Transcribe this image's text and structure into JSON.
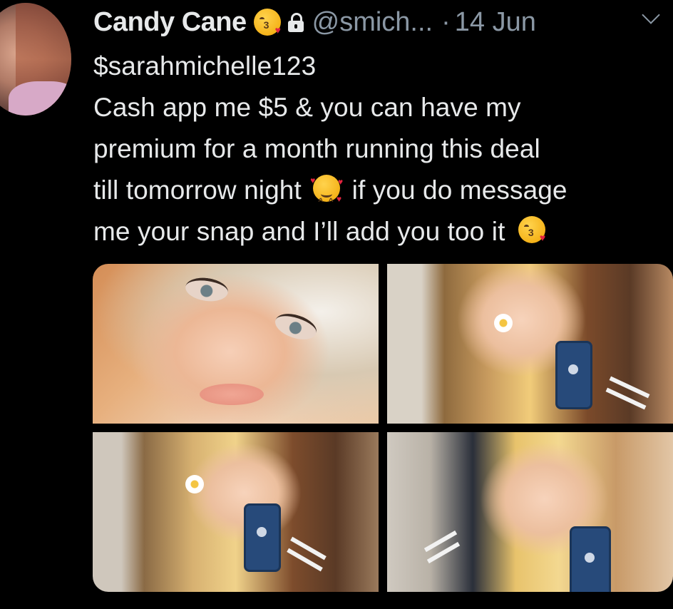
{
  "tweet": {
    "author_name": "Candy Cane",
    "author_handle": "@smich...",
    "separator": "·",
    "date": "14 Jun",
    "text_lines": [
      "$sarahmichelle123",
      "Cash app me $5 & you can have my",
      "premium for a month running this deal",
      "till tomorrow night",
      "if you do message",
      "me your snap and I’ll add you too it"
    ],
    "icons": {
      "name_emoji": "face-blowing-kiss-icon",
      "protected": "lock-icon",
      "menu": "chevron-down-icon",
      "inline_emoji_1": "smiling-face-with-hearts-icon",
      "inline_emoji_2": "face-blowing-kiss-icon"
    },
    "media_count": 4
  },
  "colors": {
    "background": "#000000",
    "primary_text": "#e7e9ea",
    "secondary_text": "#8b98a5"
  }
}
